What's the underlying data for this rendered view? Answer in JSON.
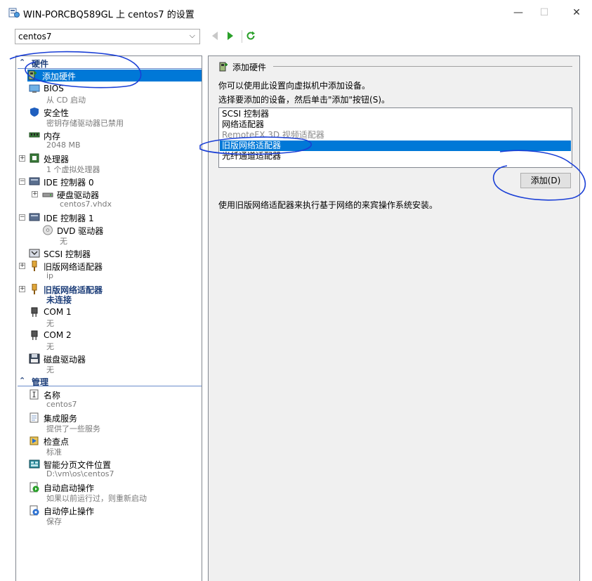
{
  "window": {
    "title": "WIN-PORCBQ589GL 上 centos7 的设置",
    "minimize": "—",
    "maximize": "☐",
    "close": "✕"
  },
  "toolbar": {
    "vm_name": "centos7"
  },
  "tree": {
    "hardware_header": "硬件",
    "management_header": "管理",
    "items": {
      "add_hardware": "添加硬件",
      "bios": "BIOS",
      "bios_sub": "从 CD 启动",
      "security": "安全性",
      "security_sub": "密钥存储驱动器已禁用",
      "memory": "内存",
      "memory_sub": "2048 MB",
      "processor": "处理器",
      "processor_sub": "1 个虚拟处理器",
      "ide0": "IDE 控制器 0",
      "hdd": "硬盘驱动器",
      "hdd_sub": "centos7.vhdx",
      "ide1": "IDE 控制器 1",
      "dvd": "DVD 驱动器",
      "dvd_sub": "无",
      "scsi": "SCSI 控制器",
      "legacy_nic1": "旧版网络适配器",
      "legacy_nic1_sub": "ip",
      "legacy_nic2": "旧版网络适配器",
      "legacy_nic2_sub": "未连接",
      "com1": "COM 1",
      "com1_sub": "无",
      "com2": "COM 2",
      "com2_sub": "无",
      "floppy": "磁盘驱动器",
      "floppy_sub": "无",
      "name": "名称",
      "name_sub": "centos7",
      "integration": "集成服务",
      "integration_sub": "提供了一些服务",
      "checkpoint": "检查点",
      "checkpoint_sub": "标准",
      "paging": "智能分页文件位置",
      "paging_sub": "D:\\vm\\os\\centos7",
      "autostart": "自动启动操作",
      "autostart_sub": "如果以前运行过，则重新启动",
      "autostop": "自动停止操作",
      "autostop_sub": "保存"
    }
  },
  "panel": {
    "title": "添加硬件",
    "line1": "你可以使用此设置向虚拟机中添加设备。",
    "line2": "选择要添加的设备，然后单击\"添加\"按钮(S)。",
    "devices": [
      "SCSI 控制器",
      "网络适配器",
      "RemoteFX 3D 视频适配器",
      "旧版网络适配器",
      "光纤通道适配器"
    ],
    "add_button": "添加(D)",
    "description": "使用旧版网络适配器来执行基于网络的来宾操作系统安装。"
  },
  "colors": {
    "selection": "#0078d7",
    "annotation": "#1a3fd6",
    "header_text": "#1e3f7a"
  }
}
